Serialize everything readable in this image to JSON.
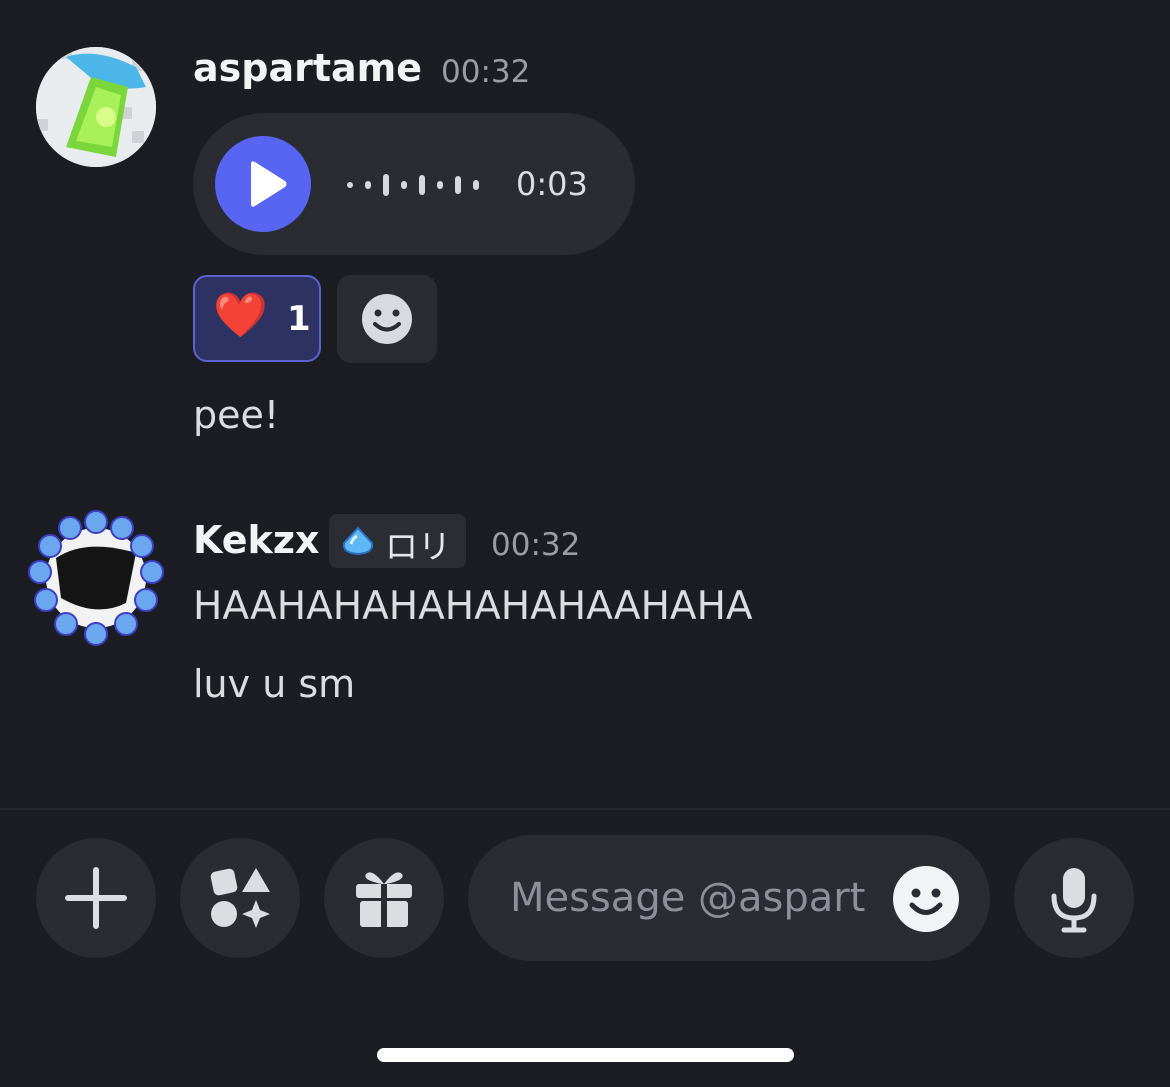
{
  "messages": [
    {
      "author": "aspartame",
      "time": "00:32",
      "voice": {
        "duration": "0:03"
      },
      "reactions": [
        {
          "emoji": "❤️",
          "count": "1"
        }
      ],
      "text": "pee!"
    },
    {
      "author": "Kekzx",
      "role_tag": "ロリ",
      "time": "00:32",
      "lines": [
        "HAAHAHAHAHAHAHAAHAHA",
        "luv u sm"
      ]
    }
  ],
  "composer": {
    "placeholder": "Message @aspart"
  },
  "icons": {
    "play": "play-icon",
    "add_reaction": "smiley-icon",
    "plus": "plus-icon",
    "apps": "apps-icon",
    "gift": "gift-icon",
    "emoji": "smiley-icon",
    "mic": "microphone-icon"
  },
  "colors": {
    "background": "#1c1d22",
    "accent": "#5865f2",
    "reaction_bg": "#2e3262"
  }
}
